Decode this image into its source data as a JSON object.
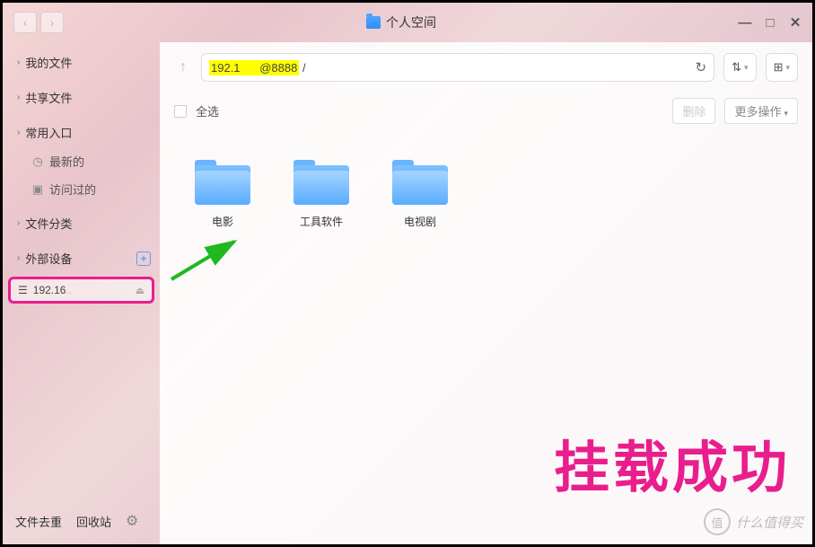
{
  "titlebar": {
    "title": "个人空间"
  },
  "sidebar": {
    "sections": [
      {
        "label": "我的文件"
      },
      {
        "label": "共享文件"
      },
      {
        "label": "常用入口",
        "items": [
          {
            "label": "最新的",
            "icon": "clock"
          },
          {
            "label": "访问过的",
            "icon": "camera"
          }
        ]
      },
      {
        "label": "文件分类"
      },
      {
        "label": "外部设备",
        "add": true
      }
    ],
    "device": {
      "label": "192.16",
      "suffix": ".."
    },
    "footer": {
      "dedupe": "文件去重",
      "recycle": "回收站"
    }
  },
  "toolbar": {
    "address_prefix": "192.1",
    "address_suffix": "@8888",
    "address_tail": "/"
  },
  "actionbar": {
    "select_all": "全选",
    "delete": "删除",
    "more": "更多操作"
  },
  "files": [
    {
      "name": "电影"
    },
    {
      "name": "工具软件"
    },
    {
      "name": "电视剧"
    }
  ],
  "overlay": {
    "success": "挂载成功",
    "watermark_badge": "值",
    "watermark_text": "什么值得买"
  }
}
